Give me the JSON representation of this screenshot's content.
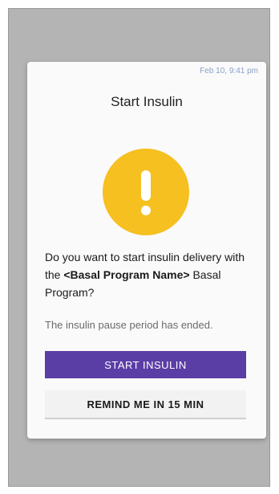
{
  "dialog": {
    "timestamp": "Feb 10, 9:41 pm",
    "title": "Start Insulin",
    "icon": "exclamation-alert-icon",
    "accent_color": "#f5c020",
    "question_prefix": "Do you want to start insulin delivery with the ",
    "program_name": "<Basal Program Name>",
    "question_suffix": " Basal Program?",
    "subtext": "The insulin pause period has ended.",
    "primary_button": {
      "label": "START INSULIN",
      "color": "#5b3da6"
    },
    "secondary_button": {
      "label": "REMIND ME IN 15 MIN"
    }
  }
}
